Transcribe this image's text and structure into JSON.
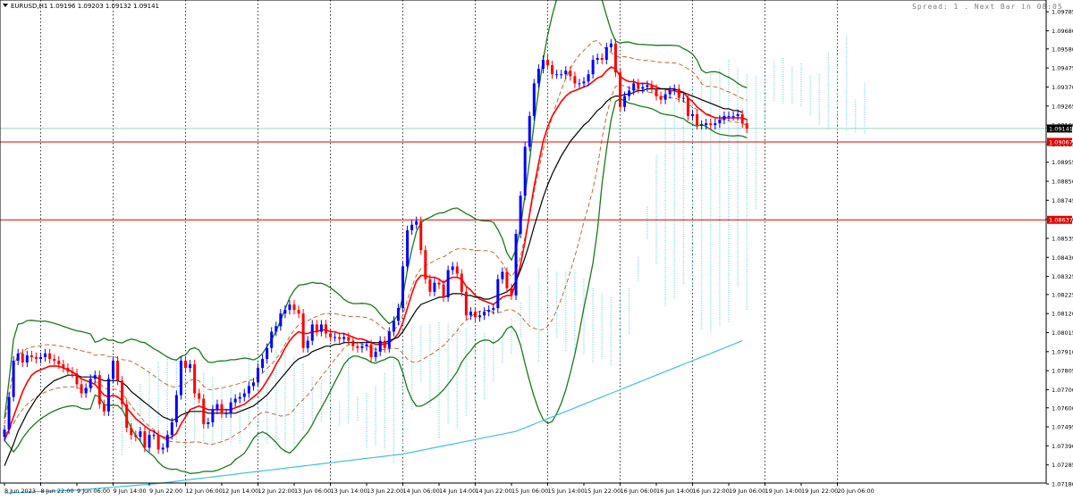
{
  "chart_data": {
    "type": "line",
    "symbol_line": "EURUSD,H1  1.09196 1.09203 1.09132 1.09141",
    "status_text": "Spread: 1 . Next Bar in 08:05",
    "ylim": [
      1.07185,
      1.0985
    ],
    "grid": "vertical-dotted",
    "y_ticks": [
      "1.09785",
      "1.09680",
      "1.09580",
      "1.09475",
      "1.09370",
      "1.09265",
      "1.09160",
      "1.09055",
      "1.08955",
      "1.08850",
      "1.08745",
      "1.08640",
      "1.08535",
      "1.08430",
      "1.08325",
      "1.08225",
      "1.08120",
      "1.08015",
      "1.07910",
      "1.07805",
      "1.07700",
      "1.07600",
      "1.07495",
      "1.07390",
      "1.07285",
      "1.07180"
    ],
    "y_tick_values": [
      1.09785,
      1.0968,
      1.0958,
      1.09475,
      1.0937,
      1.09265,
      1.0916,
      1.09055,
      1.08955,
      1.0885,
      1.08745,
      1.0864,
      1.08535,
      1.0843,
      1.08325,
      1.08225,
      1.0812,
      1.08015,
      1.0791,
      1.07805,
      1.077,
      1.076,
      1.07495,
      1.0739,
      1.07285,
      1.0718
    ],
    "x_ticks": [
      "8 Jun 2023",
      "8 Jun 22:00",
      "9 Jun 06:00",
      "9 Jun 14:00",
      "9 Jun 22:00",
      "12 Jun 06:00",
      "12 Jun 14:00",
      "12 Jun 22:00",
      "13 Jun 06:00",
      "13 Jun 14:00",
      "13 Jun 22:00",
      "14 Jun 06:00",
      "14 Jun 14:00",
      "14 Jun 22:00",
      "15 Jun 06:00",
      "15 Jun 14:00",
      "15 Jun 22:00",
      "16 Jun 06:00",
      "16 Jun 14:00",
      "16 Jun 22:00",
      "19 Jun 06:00",
      "19 Jun 14:00",
      "19 Jun 22:00",
      "20 Jun 06:00"
    ],
    "bars_per_tick": 8,
    "price_labels": [
      {
        "text": "1.09141",
        "value": 1.09141,
        "bg": "#000000",
        "color": "#ffffff"
      },
      {
        "text": "1.09067",
        "value": 1.09067,
        "bg": "#e00000",
        "color": "#ffffff"
      },
      {
        "text": "1.08637",
        "value": 1.08637,
        "bg": "#e00000",
        "color": "#ffffff"
      }
    ],
    "hlines": [
      {
        "value": 1.09067,
        "color": "#e00000"
      },
      {
        "value": 1.08637,
        "color": "#e00000"
      },
      {
        "value": 1.09141,
        "color": "#9ad3c8"
      }
    ],
    "series": [
      {
        "role": "close",
        "values": [
          1.0748,
          1.0766,
          1.0786,
          1.079,
          1.0785,
          1.0789,
          1.0788,
          1.0787,
          1.0788,
          1.079,
          1.0787,
          1.0786,
          1.0784,
          1.0782,
          1.078,
          1.0779,
          1.0773,
          1.0768,
          1.0771,
          1.0776,
          1.0778,
          1.0762,
          1.0758,
          1.0776,
          1.0786,
          1.0775,
          1.0762,
          1.0749,
          1.0745,
          1.0744,
          1.0747,
          1.0738,
          1.0745,
          1.0745,
          1.0737,
          1.0738,
          1.0745,
          1.0752,
          1.0767,
          1.0786,
          1.0782,
          1.0784,
          1.0768,
          1.0765,
          1.0751,
          1.0752,
          1.0759,
          1.0762,
          1.0757,
          1.0757,
          1.0763,
          1.0765,
          1.0766,
          1.0768,
          1.0772,
          1.0774,
          1.0782,
          1.0787,
          1.0793,
          1.0802,
          1.0805,
          1.0812,
          1.0814,
          1.0817,
          1.0814,
          1.0812,
          1.0793,
          1.0797,
          1.0806,
          1.0802,
          1.0806,
          1.0801,
          1.0799,
          1.0799,
          1.0798,
          1.0799,
          1.0797,
          1.0794,
          1.0793,
          1.0794,
          1.0795,
          1.0788,
          1.0791,
          1.0797,
          1.0793,
          1.0802,
          1.0808,
          1.0815,
          1.0838,
          1.0858,
          1.0861,
          1.0863,
          1.0847,
          1.0831,
          1.0824,
          1.0829,
          1.0828,
          1.0821,
          1.0836,
          1.0838,
          1.0834,
          1.0824,
          1.0811,
          1.0813,
          1.081,
          1.0811,
          1.0813,
          1.0814,
          1.0815,
          1.0831,
          1.0835,
          1.0826,
          1.0822,
          1.0856,
          1.0877,
          1.0904,
          1.0921,
          1.0939,
          1.0947,
          1.0952,
          1.0949,
          1.0944,
          1.0944,
          1.0944,
          1.0946,
          1.0943,
          1.0939,
          1.0939,
          1.094,
          1.0944,
          1.0952,
          1.0953,
          1.0952,
          1.0959,
          1.0961,
          1.0945,
          1.0926,
          1.0932,
          1.0935,
          1.0939,
          1.0936,
          1.0937,
          1.0938,
          1.0936,
          1.0932,
          1.093,
          1.0933,
          1.0935,
          1.0936,
          1.0931,
          1.0931,
          1.0921,
          1.0922,
          1.0916,
          1.0916,
          1.0917,
          1.0916,
          1.0917,
          1.0919,
          1.0921,
          1.0921,
          1.0921,
          1.0922,
          1.0917,
          1.0914
        ]
      },
      {
        "role": "ma-red",
        "color": "#ff0000",
        "values": [
          1.0742,
          1.0748,
          1.0755,
          1.0762,
          1.0769,
          1.0774,
          1.0778,
          1.078,
          1.0781,
          1.0782,
          1.0783,
          1.0783,
          1.0783,
          1.0782,
          1.0781,
          1.078,
          1.0778,
          1.0776,
          1.0775,
          1.0774,
          1.0773,
          1.077,
          1.0767,
          1.0766,
          1.0767,
          1.0766,
          1.0764,
          1.076,
          1.0757,
          1.0754,
          1.0752,
          1.075,
          1.0748,
          1.0747,
          1.0745,
          1.0744,
          1.0743,
          1.0744,
          1.0746,
          1.0751,
          1.0755,
          1.0759,
          1.076,
          1.0761,
          1.076,
          1.0759,
          1.0759,
          1.0759,
          1.0759,
          1.0759,
          1.0759,
          1.076,
          1.0761,
          1.0762,
          1.0764,
          1.0766,
          1.0768,
          1.0771,
          1.0775,
          1.0779,
          1.0784,
          1.0788,
          1.0793,
          1.0797,
          1.08,
          1.0802,
          1.0801,
          1.0801,
          1.0802,
          1.0802,
          1.0803,
          1.0803,
          1.0802,
          1.0802,
          1.0801,
          1.0801,
          1.08,
          1.0799,
          1.0798,
          1.0798,
          1.0797,
          1.0796,
          1.0795,
          1.0795,
          1.0795,
          1.0796,
          1.0798,
          1.0801,
          1.0807,
          1.0815,
          1.0823,
          1.083,
          1.0833,
          1.0833,
          1.0832,
          1.0832,
          1.0831,
          1.0829,
          1.0831,
          1.0832,
          1.0832,
          1.0831,
          1.0827,
          1.0825,
          1.0822,
          1.082,
          1.0819,
          1.0818,
          1.0817,
          1.0819,
          1.0821,
          1.0822,
          1.0822,
          1.0829,
          1.0839,
          1.0852,
          1.0867,
          1.0882,
          1.0895,
          1.0907,
          1.0915,
          1.0921,
          1.0925,
          1.0929,
          1.0932,
          1.0934,
          1.0935,
          1.0936,
          1.0937,
          1.0938,
          1.094,
          1.0942,
          1.0943,
          1.0946,
          1.0948,
          1.0947,
          1.0943,
          1.0941,
          1.094,
          1.094,
          1.0939,
          1.0939,
          1.0939,
          1.0938,
          1.0937,
          1.0936,
          1.0936,
          1.0935,
          1.0935,
          1.0934,
          1.0934,
          1.0931,
          1.0929,
          1.0926,
          1.0924,
          1.0922,
          1.0921,
          1.092,
          1.092,
          1.092,
          1.092,
          1.092,
          1.092,
          1.092,
          1.0919
        ]
      },
      {
        "role": "ma-black",
        "color": "#000000",
        "values": [
          1.0728,
          1.0734,
          1.074,
          1.0747,
          1.0752,
          1.0757,
          1.0761,
          1.0765,
          1.0768,
          1.0771,
          1.0773,
          1.0775,
          1.0776,
          1.0777,
          1.0778,
          1.0778,
          1.0778,
          1.0777,
          1.0777,
          1.0777,
          1.0777,
          1.0776,
          1.0775,
          1.0775,
          1.0775,
          1.0775,
          1.0774,
          1.0772,
          1.0769,
          1.0767,
          1.0765,
          1.0763,
          1.0761,
          1.0759,
          1.0757,
          1.0755,
          1.0754,
          1.0753,
          1.0754,
          1.0756,
          1.0757,
          1.0758,
          1.0758,
          1.0758,
          1.0758,
          1.0757,
          1.0757,
          1.0757,
          1.0757,
          1.0757,
          1.0757,
          1.0757,
          1.0758,
          1.0759,
          1.076,
          1.0761,
          1.0763,
          1.0765,
          1.0767,
          1.077,
          1.0773,
          1.0776,
          1.0779,
          1.0782,
          1.0785,
          1.0787,
          1.0788,
          1.0789,
          1.0791,
          1.0792,
          1.0793,
          1.0794,
          1.0794,
          1.0795,
          1.0795,
          1.0796,
          1.0796,
          1.0796,
          1.0796,
          1.0796,
          1.0796,
          1.0796,
          1.0796,
          1.0796,
          1.0796,
          1.0797,
          1.0798,
          1.0799,
          1.0802,
          1.0806,
          1.081,
          1.0814,
          1.0817,
          1.0818,
          1.0819,
          1.082,
          1.0821,
          1.0821,
          1.0822,
          1.0823,
          1.0823,
          1.0823,
          1.0822,
          1.0822,
          1.0821,
          1.0821,
          1.082,
          1.082,
          1.0821,
          1.0822,
          1.0823,
          1.0824,
          1.0826,
          1.083,
          1.0836,
          1.0843,
          1.0851,
          1.086,
          1.0868,
          1.0876,
          1.0883,
          1.0889,
          1.0894,
          1.0899,
          1.0903,
          1.0907,
          1.091,
          1.0913,
          1.0916,
          1.0918,
          1.0921,
          1.0924,
          1.0926,
          1.0929,
          1.0931,
          1.0932,
          1.0932,
          1.0933,
          1.0933,
          1.0934,
          1.0935,
          1.0935,
          1.0936,
          1.0936,
          1.0936,
          1.0936,
          1.0936,
          1.0936,
          1.0936,
          1.0935,
          1.0934,
          1.0933,
          1.0932,
          1.0931,
          1.093,
          1.0929,
          1.0928,
          1.0927,
          1.0926,
          1.0925,
          1.0925,
          1.0924,
          1.0924,
          1.0923
        ]
      },
      {
        "role": "ma-cyan",
        "color": "#40c0e0",
        "values": [
          1.0713,
          1.07131,
          1.07132,
          1.07133,
          1.07134,
          1.07135,
          1.07136,
          1.07137,
          1.07138,
          1.07139,
          1.0714,
          1.07141,
          1.07142,
          1.07143,
          1.07144,
          1.07145,
          1.07146,
          1.07148,
          1.0715,
          1.07152,
          1.07154,
          1.07156,
          1.07158,
          1.0716,
          1.07162,
          1.07164,
          1.07166,
          1.07168,
          1.0717,
          1.07172,
          1.07174,
          1.07176,
          1.07178,
          1.0718,
          1.07183,
          1.07186,
          1.07189,
          1.07192,
          1.07195,
          1.07198,
          1.07201,
          1.07204,
          1.07207,
          1.0721,
          1.07213,
          1.07216,
          1.07219,
          1.07222,
          1.07225,
          1.07228,
          1.07231,
          1.07234,
          1.07237,
          1.0724,
          1.07243,
          1.07246,
          1.07249,
          1.07252,
          1.07255,
          1.07258,
          1.07261,
          1.07264,
          1.07267,
          1.0727,
          1.07273,
          1.07276,
          1.07279,
          1.07282,
          1.07285,
          1.07288,
          1.07291,
          1.07294,
          1.07297,
          1.073,
          1.07303,
          1.07306,
          1.07309,
          1.07312,
          1.07315,
          1.07318,
          1.07321,
          1.07324,
          1.07327,
          1.0733,
          1.07333,
          1.07336,
          1.07339,
          1.07342,
          1.07345,
          1.0735,
          1.07355,
          1.0736,
          1.07365,
          1.0737,
          1.07375,
          1.0738,
          1.07385,
          1.0739,
          1.07395,
          1.074,
          1.07405,
          1.0741,
          1.07415,
          1.0742,
          1.07425,
          1.0743,
          1.07435,
          1.0744,
          1.07445,
          1.0745,
          1.07455,
          1.0746,
          1.07465,
          1.0747,
          1.0748,
          1.0749,
          1.075,
          1.0751,
          1.0752,
          1.0753,
          1.0754,
          1.0755,
          1.0756,
          1.0757,
          1.0758,
          1.0759,
          1.076,
          1.0761,
          1.0762,
          1.0763,
          1.0764,
          1.0765,
          1.0766,
          1.0767,
          1.0768,
          1.0769,
          1.077,
          1.0771,
          1.0772,
          1.0773,
          1.0774,
          1.0775,
          1.0776,
          1.0777,
          1.0778,
          1.0779,
          1.078,
          1.0781,
          1.0782,
          1.0783,
          1.0784,
          1.0785,
          1.0786,
          1.0787,
          1.0788,
          1.0789,
          1.079,
          1.0791,
          1.0792,
          1.0793,
          1.0794,
          1.0795,
          1.0796,
          1.0797
        ]
      }
    ]
  }
}
